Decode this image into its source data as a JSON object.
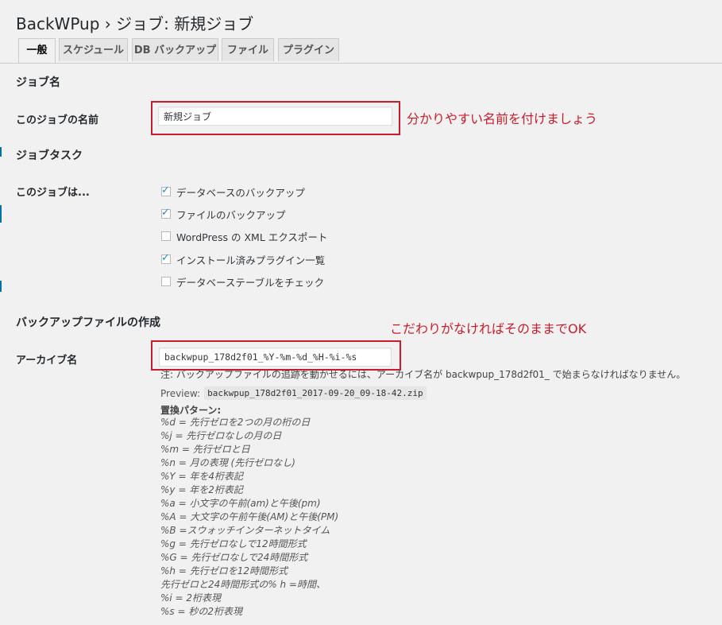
{
  "page_title": "BackWPup › ジョブ: 新規ジョブ",
  "tabs": [
    {
      "label": "一般",
      "active": true
    },
    {
      "label": "スケジュール",
      "active": false
    },
    {
      "label": "DB バックアップ",
      "active": false
    },
    {
      "label": "ファイル",
      "active": false
    },
    {
      "label": "プラグイン",
      "active": false
    }
  ],
  "job_name_section": {
    "heading": "ジョブ名",
    "field_label": "このジョブの名前",
    "value": "新規ジョブ",
    "annotation": "分かりやすい名前を付けましょう"
  },
  "job_tasks_section": {
    "heading": "ジョブタスク",
    "field_label": "このジョブは...",
    "tasks": [
      {
        "label": "データベースのバックアップ",
        "checked": true
      },
      {
        "label": "ファイルのバックアップ",
        "checked": true
      },
      {
        "label": "WordPress の XML エクスポート",
        "checked": false
      },
      {
        "label": "インストール済みプラグイン一覧",
        "checked": true
      },
      {
        "label": "データベーステーブルをチェック",
        "checked": false
      }
    ]
  },
  "archive_section": {
    "heading": "バックアップファイルの作成",
    "annotation": "こだわりがなければそのままでOK",
    "field_label": "アーカイブ名",
    "value": "backwpup_178d2f01_%Y-%m-%d_%H-%i-%s",
    "note": "注: バックアップファイルの追跡を動かせるには、アーカイブ名が backwpup_178d2f01_ で始まらなければなりません。",
    "preview_label": "Preview:",
    "preview_value": "backwpup_178d2f01_2017-09-20_09-18-42.zip",
    "replacement_title": "置換パターン:",
    "replacements": [
      "%d = 先行ゼロを2つの月の桁の日",
      "%j = 先行ゼロなしの月の日",
      "%m = 先行ゼロと日",
      "%n = 月の表現 (先行ゼロなし)",
      "%Y = 年を4桁表記",
      "%y = 年を2桁表記",
      "%a = 小文字の午前(am)と午後(pm)",
      "%A = 大文字の午前午後(AM)と午後(PM)",
      "%B =スウォッチインターネットタイム",
      "%g = 先行ゼロなしで12時間形式",
      "%G = 先行ゼロなしで24時間形式",
      "%h = 先行ゼロを12時間形式",
      "先行ゼロと24時間形式の% h =時間、",
      "%i = 2桁表現",
      "%s = 秒の2桁表現"
    ]
  },
  "colors": {
    "background": "#f1f1f1",
    "annotation_red": "#cc1c2b",
    "checkbox_tick": "#1e8cbe",
    "admin_blue": "#0073aa"
  }
}
